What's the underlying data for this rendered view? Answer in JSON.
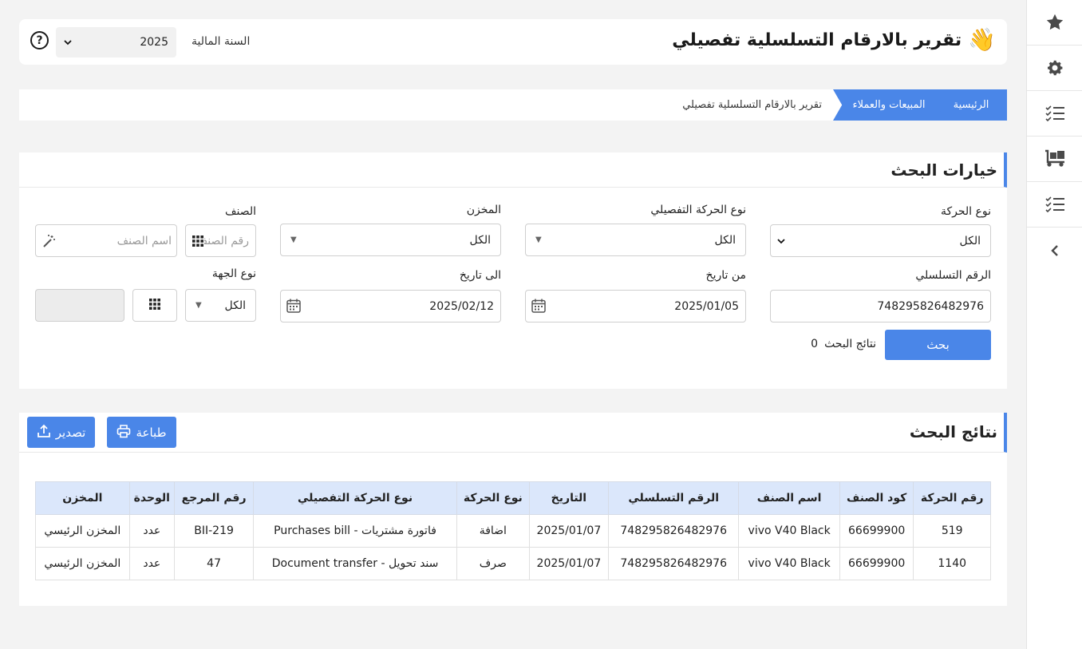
{
  "header": {
    "title": "تقرير بالارقام التسلسلية تفصيلي",
    "title_icon": "waving-hand-emoji",
    "year_label": "السنة المالية",
    "year_value": "2025",
    "help_icon": "question-circle-icon"
  },
  "sidebar": {
    "items": [
      {
        "icon": "star-icon"
      },
      {
        "icon": "gear-icon"
      },
      {
        "icon": "checklist-icon"
      },
      {
        "icon": "dolly-boxes-icon"
      },
      {
        "icon": "checklist-icon"
      },
      {
        "icon": "chevron-left-icon"
      }
    ]
  },
  "breadcrumb": {
    "home": "الرئيسية",
    "section": "المبيعات والعملاء",
    "current": "تقرير بالارقام التسلسلية تفصيلي"
  },
  "search": {
    "title": "خيارات البحث",
    "movement_type_label": "نوع الحركة",
    "movement_type_value": "الكل",
    "detail_type_label": "نوع الحركة التفصيلي",
    "detail_type_value": "الكل",
    "warehouse_label": "المخزن",
    "warehouse_value": "الكل",
    "item_label": "الصنف",
    "item_code_placeholder": "رقم الصنف",
    "item_name_placeholder": "اسم الصنف",
    "serial_label": "الرقم التسلسلي",
    "serial_value": "748295826482976",
    "from_date_label": "من تاريخ",
    "from_date_value": "2025/01/05",
    "to_date_label": "الى تاريخ",
    "to_date_value": "2025/02/12",
    "party_type_label": "نوع الجهة",
    "party_type_value": "الكل",
    "search_button": "بحث",
    "results_label": "نتائج البحث",
    "results_count": "0"
  },
  "results": {
    "title": "نتائج البحث",
    "print_button": "طباعة",
    "export_button": "تصدير",
    "columns": [
      "رقم الحركة",
      "كود الصنف",
      "اسم الصنف",
      "الرقم التسلسلي",
      "التاريخ",
      "نوع الحركة",
      "نوع الحركة التفصيلي",
      "رقم المرجع",
      "الوحدة",
      "المخزن"
    ],
    "rows": [
      [
        "519",
        "66699900",
        "vivo V40 Black",
        "748295826482976",
        "2025/01/07",
        "اضافة",
        "فاتورة مشتريات - Purchases bill",
        "BII-219",
        "عدد",
        "المخزن الرئيسي"
      ],
      [
        "1140",
        "66699900",
        "vivo V40 Black",
        "748295826482976",
        "2025/01/07",
        "صرف",
        "سند تحويل - Document transfer",
        "47",
        "عدد",
        "المخزن الرئيسي"
      ]
    ]
  },
  "colors": {
    "accent": "#4a86e8",
    "table_header": "#dbe7fb"
  }
}
